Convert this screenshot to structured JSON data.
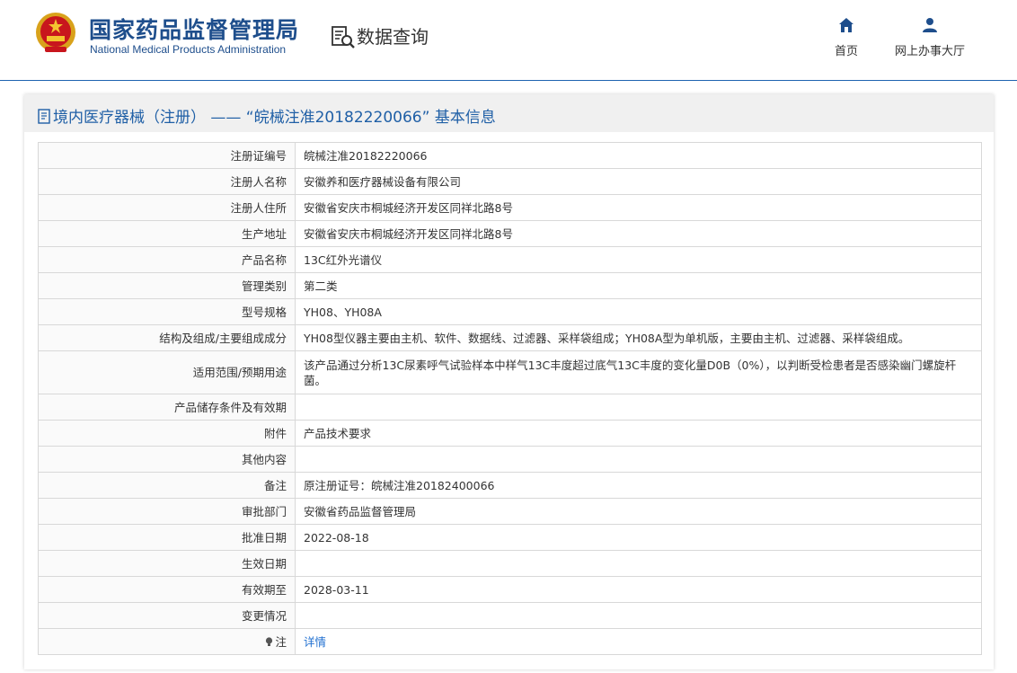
{
  "header": {
    "site_title": "国家药品监督管理局",
    "site_subtitle": "National Medical Products Administration",
    "query_title": "数据查询",
    "nav": [
      {
        "label": "首页",
        "icon": "home-icon"
      },
      {
        "label": "网上办事大厅",
        "icon": "user-icon"
      }
    ]
  },
  "colors": {
    "brand": "#1e4e8c",
    "link": "#1f6fd0",
    "title_blue": "#1f5fa6"
  },
  "panel": {
    "title": "境内医疗器械（注册） —— “皖械注准20182220066” 基本信息"
  },
  "rows": [
    {
      "label": "注册证编号",
      "value": "皖械注准20182220066"
    },
    {
      "label": "注册人名称",
      "value": "安徽养和医疗器械设备有限公司"
    },
    {
      "label": "注册人住所",
      "value": "安徽省安庆市桐城经济开发区同祥北路8号"
    },
    {
      "label": "生产地址",
      "value": "安徽省安庆市桐城经济开发区同祥北路8号"
    },
    {
      "label": "产品名称",
      "value": "13C红外光谱仪"
    },
    {
      "label": "管理类别",
      "value": "第二类"
    },
    {
      "label": "型号规格",
      "value": "YH08、YH08A"
    },
    {
      "label": "结构及组成/主要组成成分",
      "value": "YH08型仪器主要由主机、软件、数据线、过滤器、采样袋组成；YH08A型为单机版，主要由主机、过滤器、采样袋组成。"
    },
    {
      "label": "适用范围/预期用途",
      "value": "该产品通过分析13C尿素呼气试验样本中样气13C丰度超过底气13C丰度的变化量D0B（0%），以判断受检患者是否感染幽门螺旋杆菌。"
    },
    {
      "label": "产品储存条件及有效期",
      "value": ""
    },
    {
      "label": "附件",
      "value": "产品技术要求"
    },
    {
      "label": "其他内容",
      "value": ""
    },
    {
      "label": "备注",
      "value": "原注册证号：皖械注准20182400066"
    },
    {
      "label": "审批部门",
      "value": "安徽省药品监督管理局"
    },
    {
      "label": "批准日期",
      "value": "2022-08-18"
    },
    {
      "label": "生效日期",
      "value": ""
    },
    {
      "label": "有效期至",
      "value": "2028-03-11"
    },
    {
      "label": "变更情况",
      "value": ""
    }
  ],
  "note_row": {
    "label": "注",
    "link_text": "详情",
    "icon": "lightbulb-icon"
  }
}
